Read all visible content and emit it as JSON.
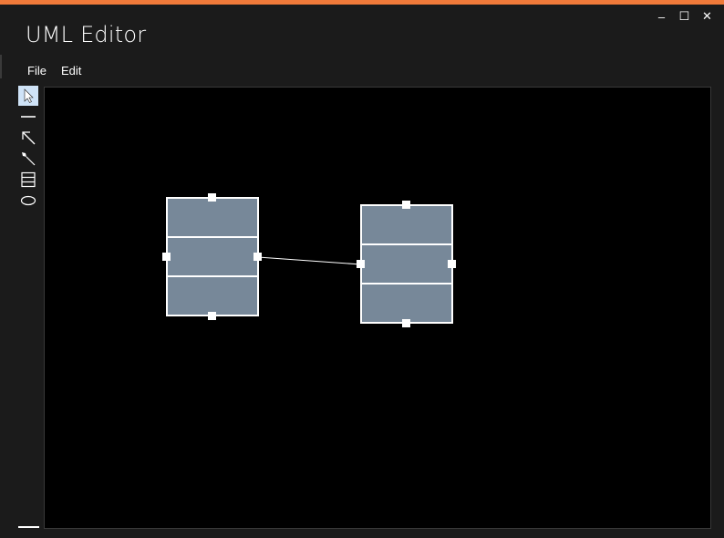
{
  "window": {
    "title": "UML Editor",
    "accent_color": "#f07a3a",
    "controls": {
      "minimize": "–",
      "maximize": "☐",
      "close": "✕"
    }
  },
  "menu": {
    "items": [
      "File",
      "Edit"
    ]
  },
  "toolbar": {
    "tools": [
      {
        "name": "select-tool",
        "icon": "cursor-arrow-icon",
        "active": true
      },
      {
        "name": "line-tool",
        "icon": "horizontal-line-icon",
        "active": false
      },
      {
        "name": "arrow-tool",
        "icon": "diagonal-arrow-icon",
        "active": false
      },
      {
        "name": "composition-tool",
        "icon": "diamond-line-icon",
        "active": false
      },
      {
        "name": "class-tool",
        "icon": "class-box-icon",
        "active": false
      },
      {
        "name": "use-case-tool",
        "icon": "ellipse-icon",
        "active": false
      }
    ],
    "active_color": "#cfe3f7"
  },
  "canvas": {
    "background": "#000000",
    "class_fill": "#778899",
    "class_stroke": "#ffffff",
    "class_count": 2,
    "compartments_per_class": 3,
    "connection_count": 1
  }
}
